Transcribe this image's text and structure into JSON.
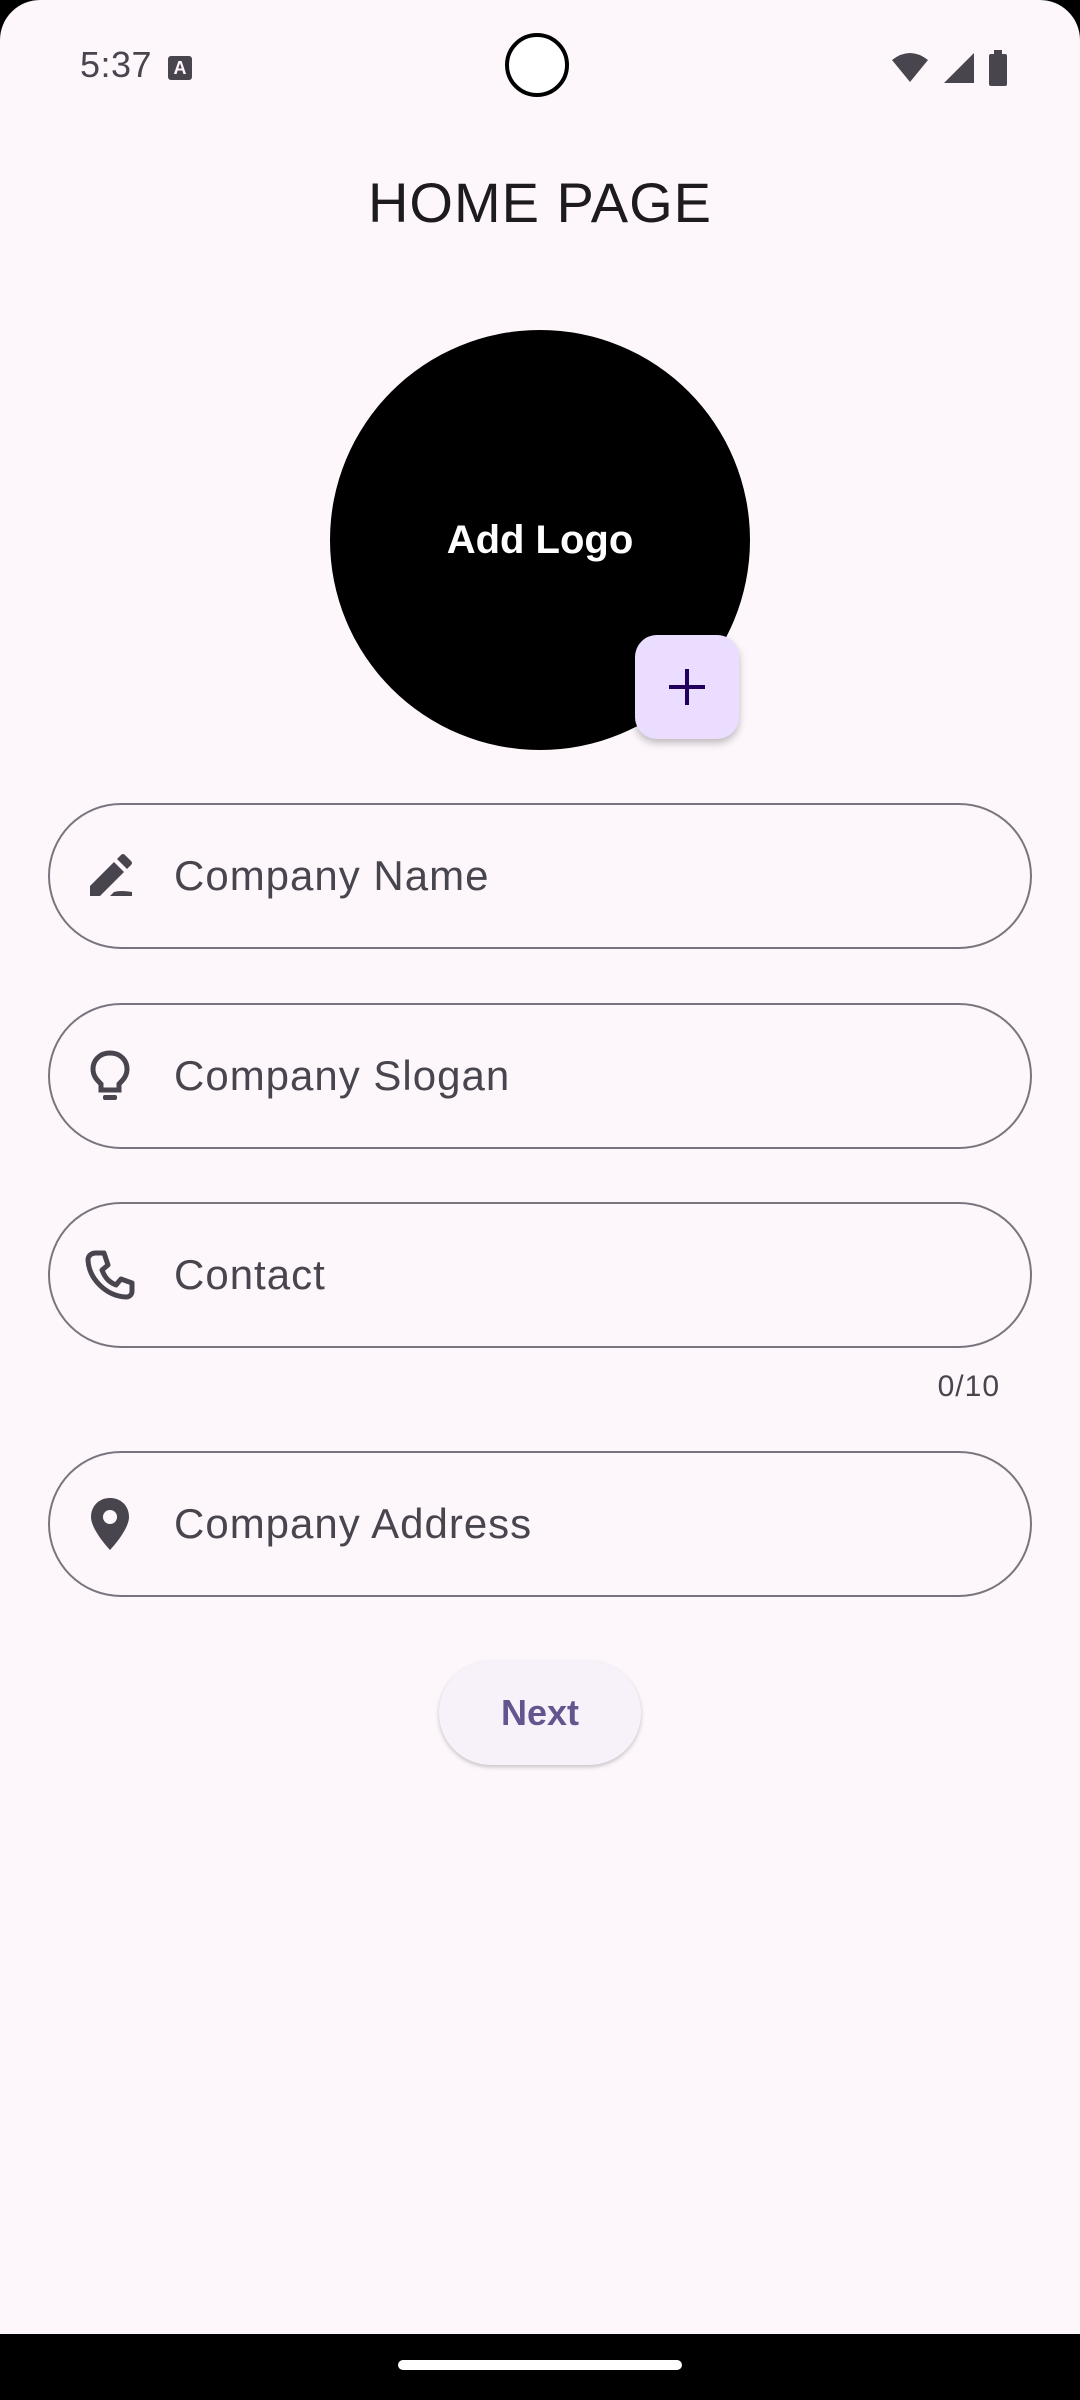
{
  "status_bar": {
    "time": "5:37",
    "notification_icon_letter": "A",
    "icons": [
      "wifi-icon",
      "signal-icon",
      "battery-icon"
    ]
  },
  "header": {
    "title": "HOME PAGE"
  },
  "logo": {
    "label": "Add Logo",
    "add_button_icon": "plus-icon"
  },
  "form": {
    "company_name": {
      "placeholder": "Company Name",
      "icon": "edit-pen-icon"
    },
    "company_slogan": {
      "placeholder": "Company Slogan",
      "icon": "lightbulb-icon"
    },
    "contact": {
      "placeholder": "Contact",
      "icon": "phone-icon",
      "counter": "0/10"
    },
    "company_address": {
      "placeholder": "Company Address",
      "icon": "location-pin-icon"
    }
  },
  "actions": {
    "next_label": "Next"
  },
  "colors": {
    "background": "#fdf7fb",
    "fab": "#eaddff",
    "primary_text": "#65558f",
    "outline": "#79747e"
  }
}
